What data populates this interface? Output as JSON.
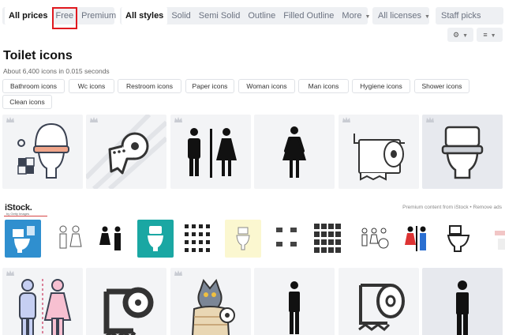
{
  "filters": {
    "price": {
      "options": [
        "All prices",
        "Free",
        "Premium"
      ],
      "active": "All prices",
      "highlighted": "Free"
    },
    "style": {
      "options": [
        "All styles",
        "Solid",
        "Semi Solid",
        "Outline",
        "Filled Outline",
        "More"
      ],
      "active": "All styles"
    },
    "license": "All licenses",
    "staff": "Staff picks"
  },
  "tools": {
    "settings_icon": "gear-icon",
    "sort_icon": "sort-icon"
  },
  "page": {
    "title": "Toilet icons",
    "result_count": "About 6,400 icons in 0.015 seconds"
  },
  "related_tags": [
    "Bathroom icons",
    "Wc icons",
    "Restroom icons",
    "Paper icons",
    "Woman icons",
    "Man icons",
    "Hygiene icons",
    "Shower icons",
    "Clean icons"
  ],
  "istock": {
    "logo": "iStock.",
    "sublogo": "by Getty Images",
    "note": "Premium content from iStock",
    "separator": "•",
    "remove_ads": "Remove ads"
  },
  "colors": {
    "highlight": "#e0191f",
    "crown": "#c9ccd3",
    "card_bg": "#f3f4f6"
  },
  "icon_rows": [
    [
      "toilet-bathroom-icon",
      "toilet-paper-icon",
      "restroom-man-woman-icon",
      "woman-icon",
      "toilet-paper-holder-icon",
      "toilet-bowl-icon"
    ],
    [
      "restroom-couple-icon",
      "toilet-paper-outline-icon",
      "cat-with-toilet-paper-icon",
      "man-icon",
      "toilet-paper-outline-icon",
      "man-icon"
    ]
  ]
}
